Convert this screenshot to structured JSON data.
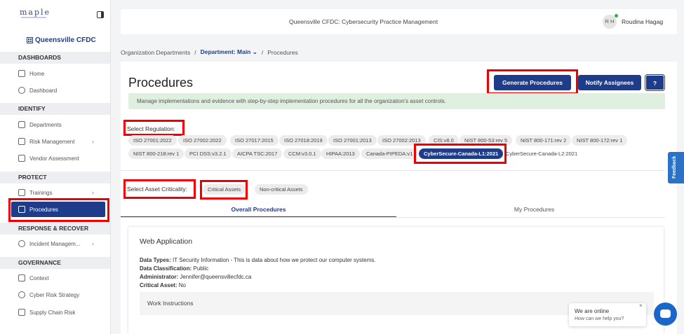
{
  "sidebar": {
    "logo": "maple",
    "org_name": "Queensville CFDC",
    "sections": {
      "dashboards": "DASHBOARDS",
      "identify": "IDENTIFY",
      "protect": "PROTECT",
      "respond": "RESPONSE & RECOVER",
      "governance": "GOVERNANCE"
    },
    "items": {
      "home": "Home",
      "dashboard": "Dashboard",
      "departments": "Departments",
      "risk": "Risk Management",
      "vendor": "Vendor Assessment",
      "trainings": "Trainings",
      "procedures": "Procedures",
      "incident": "Incident Managem...",
      "context": "Context",
      "cyber_strategy": "Cyber Risk Strategy",
      "supply_chain": "Supply Chain Risk"
    }
  },
  "header": {
    "title": "Queensville CFDC: Cybersecurity Practice Management",
    "avatar_initials": "R H",
    "user_name": "Roudina Hagag"
  },
  "breadcrumb": {
    "root": "Organization Departments",
    "department": "Department: Main",
    "current": "Procedures"
  },
  "page": {
    "title": "Procedures",
    "generate_button": "Generate Procedures",
    "notify_button": "Notify Assignees",
    "help_icon": "?",
    "info": "Manage implementations and evidence with step-by-step implementation procedures for all the organization's asset controls."
  },
  "regulation": {
    "label": "Select Regulation:",
    "row1": [
      "ISO 27001:2022",
      "ISO 27002:2022",
      "ISO 27017:2015",
      "ISO 27018:2019",
      "ISO 27001:2013",
      "ISO 27002:2013",
      "CIS:v8.0",
      "NIST 800-53:rev 5",
      "NIST 800-171:rev 2",
      "NIST 800-172:rev 1"
    ],
    "row2": [
      "NIST 800-218:rev 1",
      "PCI DSS:v3.2.1",
      "AICPA TSC:2017",
      "CCM:v3.0.1",
      "HIPAA:2013",
      "Canada-PIPEDA:v1",
      "CyberSecure-Canada-L1:2021",
      "CyberSecure-Canada-L2:2021"
    ],
    "selected": "CyberSecure-Canada-L1:2021"
  },
  "criticality": {
    "label": "Select Asset Criticality:",
    "options": [
      "Critical Assets",
      "Non-critical Assets"
    ]
  },
  "tabs": [
    "Overall Procedures",
    "My Procedures"
  ],
  "card": {
    "title": "Web Application",
    "data_types_label": "Data Types:",
    "data_types": "IT Security Information - This is data about how we protect our computer systems.",
    "classification_label": "Data Classification:",
    "classification": "Public",
    "admin_label": "Administrator:",
    "admin": "Jennifer@queensvillecfdc.ca",
    "critical_label": "Critical Asset:",
    "critical": "No",
    "work_instructions": "Work Instructions"
  },
  "feedback": "Feedback",
  "chat": {
    "line1": "We are online",
    "line2": "How can we help you?"
  },
  "colors": {
    "primary": "#1f3c8a",
    "highlight": "#ee0000",
    "info_bg": "#dff0e1"
  }
}
